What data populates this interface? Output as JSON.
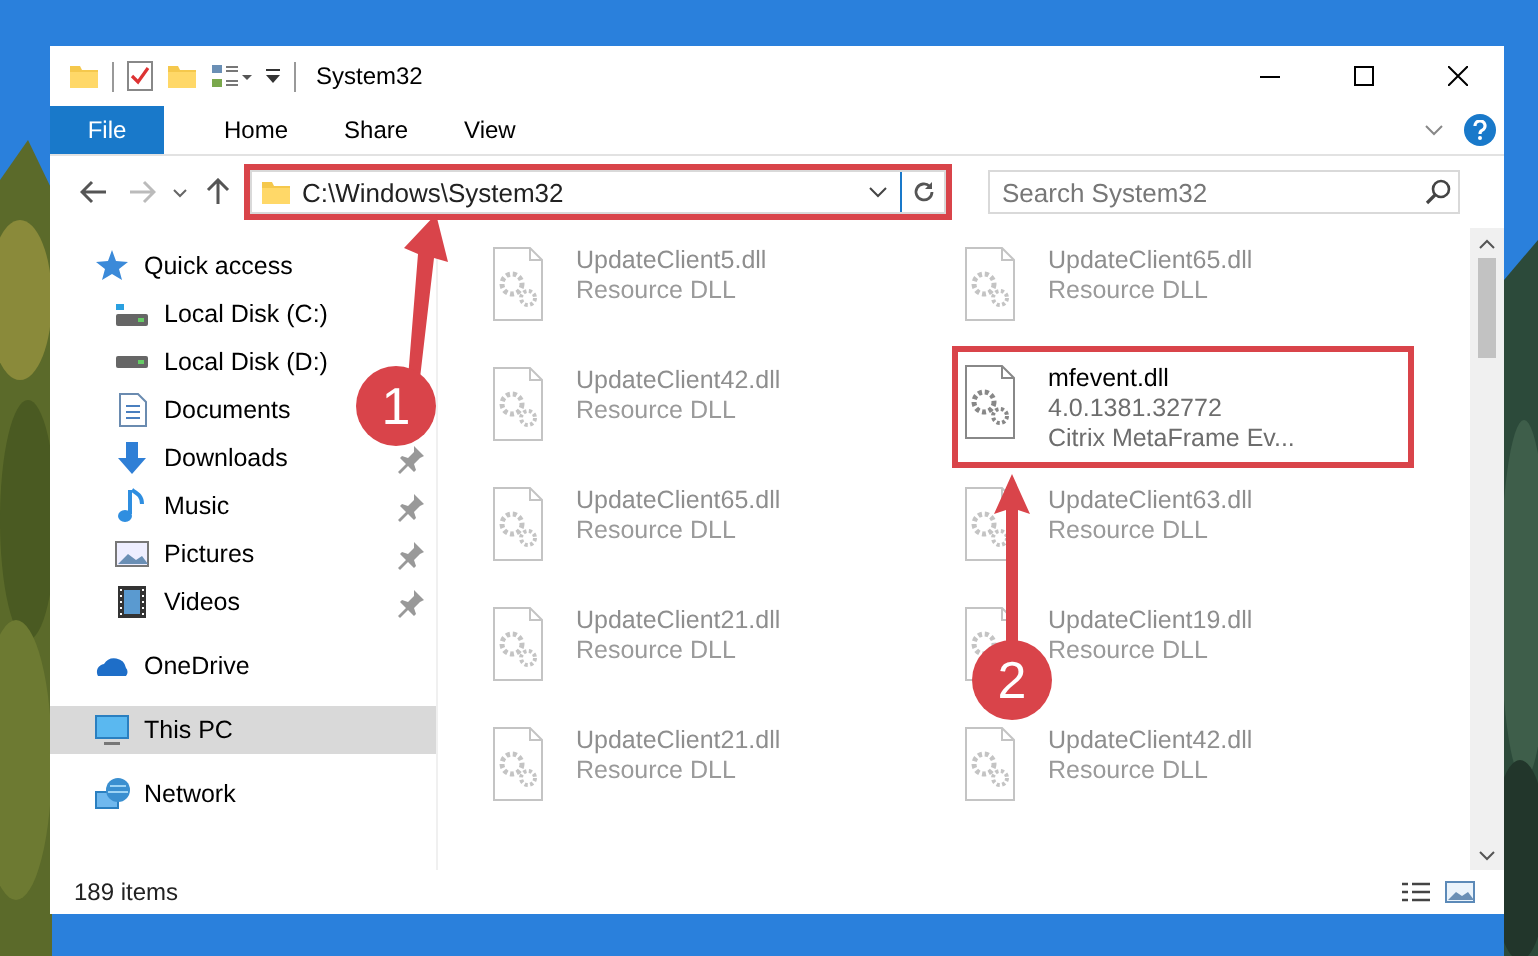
{
  "window": {
    "title": "System32"
  },
  "ribbon": {
    "tabs": [
      {
        "label": "File",
        "kind": "file"
      },
      {
        "label": "Home",
        "kind": "tab"
      },
      {
        "label": "Share",
        "kind": "tab"
      },
      {
        "label": "View",
        "kind": "tab"
      }
    ]
  },
  "address_bar": {
    "path": "C:\\Windows\\System32",
    "highlighted": true
  },
  "search": {
    "placeholder": "Search System32"
  },
  "navigation": {
    "items": [
      {
        "label": "Quick access",
        "kind": "star",
        "selected": false,
        "children": [
          {
            "label": "Local Disk (C:)",
            "kind": "disk-c",
            "pinned": false
          },
          {
            "label": "Local Disk (D:)",
            "kind": "disk",
            "pinned": false
          },
          {
            "label": "Documents",
            "kind": "documents",
            "pinned": false
          },
          {
            "label": "Downloads",
            "kind": "downloads",
            "pinned": true
          },
          {
            "label": "Music",
            "kind": "music",
            "pinned": true
          },
          {
            "label": "Pictures",
            "kind": "pictures",
            "pinned": true
          },
          {
            "label": "Videos",
            "kind": "videos",
            "pinned": true
          }
        ]
      },
      {
        "label": "OneDrive",
        "kind": "cloud",
        "selected": false
      },
      {
        "label": "This PC",
        "kind": "pc",
        "selected": true
      },
      {
        "label": "Network",
        "kind": "network",
        "selected": false
      }
    ]
  },
  "files": [
    {
      "name": "UpdateClient5.dll",
      "type": "Resource DLL",
      "kind": "faded",
      "highlighted": false
    },
    {
      "name": "UpdateClient65.dll",
      "type": "Resource DLL",
      "kind": "faded",
      "highlighted": false
    },
    {
      "name": "UpdateClient42.dll",
      "type": "Resource DLL",
      "kind": "faded",
      "highlighted": false
    },
    {
      "name": "mfevent.dll",
      "version": "4.0.1381.32772",
      "description": "Citrix MetaFrame Ev...",
      "kind": "sharp",
      "highlighted": true
    },
    {
      "name": "UpdateClient65.dll",
      "type": "Resource DLL",
      "kind": "faded",
      "highlighted": false
    },
    {
      "name": "UpdateClient63.dll",
      "type": "Resource DLL",
      "kind": "faded",
      "highlighted": false
    },
    {
      "name": "UpdateClient21.dll",
      "type": "Resource DLL",
      "kind": "faded",
      "highlighted": false
    },
    {
      "name": "UpdateClient19.dll",
      "type": "Resource DLL",
      "kind": "faded",
      "highlighted": false
    },
    {
      "name": "UpdateClient21.dll",
      "type": "Resource DLL",
      "kind": "faded",
      "highlighted": false
    },
    {
      "name": "UpdateClient42.dll",
      "type": "Resource DLL",
      "kind": "faded",
      "highlighted": false
    }
  ],
  "status_bar": {
    "item_count": "189 items"
  },
  "callouts": [
    {
      "number": "1"
    },
    {
      "number": "2"
    }
  ]
}
